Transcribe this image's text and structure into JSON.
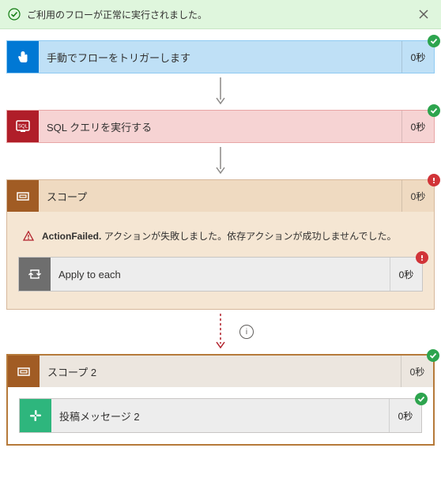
{
  "banner": {
    "message": "ご利用のフローが正常に実行されました。"
  },
  "steps": {
    "trigger": {
      "title": "手動でフローをトリガーします",
      "duration": "0秒",
      "status": "success"
    },
    "sql": {
      "title": "SQL クエリを実行する",
      "duration": "0秒",
      "status": "success"
    },
    "scope1": {
      "title": "スコープ",
      "duration": "0秒",
      "status": "error",
      "error_label": "ActionFailed.",
      "error_text": "アクションが失敗しました。依存アクションが成功しませんでした。",
      "apply": {
        "title": "Apply to each",
        "duration": "0秒",
        "status": "error"
      }
    },
    "scope2": {
      "title": "スコープ 2",
      "duration": "0秒",
      "status": "success",
      "post": {
        "title": "投稿メッセージ 2",
        "duration": "0秒",
        "status": "success"
      }
    }
  }
}
